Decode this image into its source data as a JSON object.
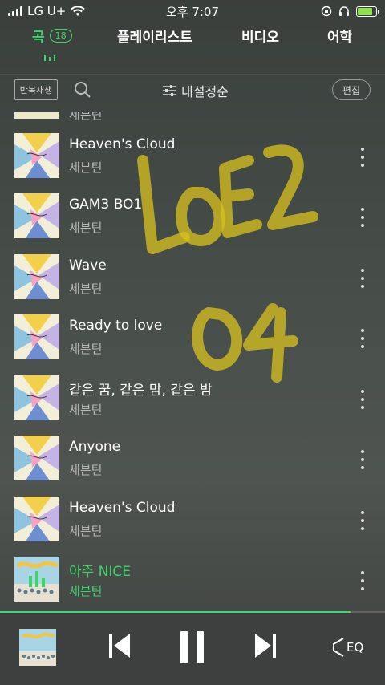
{
  "status": {
    "carrier": "LG U+",
    "time": "오후 7:07"
  },
  "tabs": [
    {
      "label": "곡",
      "count": "18"
    },
    {
      "label": "플레이리스트"
    },
    {
      "label": "비디오"
    },
    {
      "label": "어학"
    }
  ],
  "toolbar": {
    "repeat_label": "반복재생",
    "sort_label": "내설정순",
    "edit_label": "편집"
  },
  "partial_artist": "세븐틴",
  "songs": [
    {
      "title": "Heaven's Cloud",
      "artist": "세븐틴",
      "art": "ode",
      "playing": false
    },
    {
      "title": "GAM3 BO1",
      "artist": "세븐틴",
      "art": "ode",
      "playing": false
    },
    {
      "title": "Wave",
      "artist": "세븐틴",
      "art": "ode",
      "playing": false
    },
    {
      "title": "Ready to love",
      "artist": "세븐틴",
      "art": "ode",
      "playing": false
    },
    {
      "title": "같은 꿈, 같은 맘, 같은 밤",
      "artist": "세븐틴",
      "art": "ode",
      "playing": false
    },
    {
      "title": "Anyone",
      "artist": "세븐틴",
      "art": "ode",
      "playing": false
    },
    {
      "title": "Heaven's Cloud",
      "artist": "세븐틴",
      "art": "ode",
      "playing": false
    },
    {
      "title": "아주 NICE",
      "artist": "세븐틴",
      "art": "nice",
      "playing": true
    }
  ],
  "overlay_text": [
    "LOEZ",
    "04"
  ],
  "player": {
    "eq_label": "EQ",
    "progress": 0.91
  },
  "colors": {
    "accent": "#3fd46a",
    "overlay": "#d9c21e",
    "background": "#454c48"
  },
  "icons": {
    "search": "search-icon",
    "sort": "sliders-icon",
    "more": "more-vertical-icon",
    "prev": "skip-previous-icon",
    "pause": "pause-icon",
    "next": "skip-next-icon",
    "eq": "equalizer-icon"
  }
}
